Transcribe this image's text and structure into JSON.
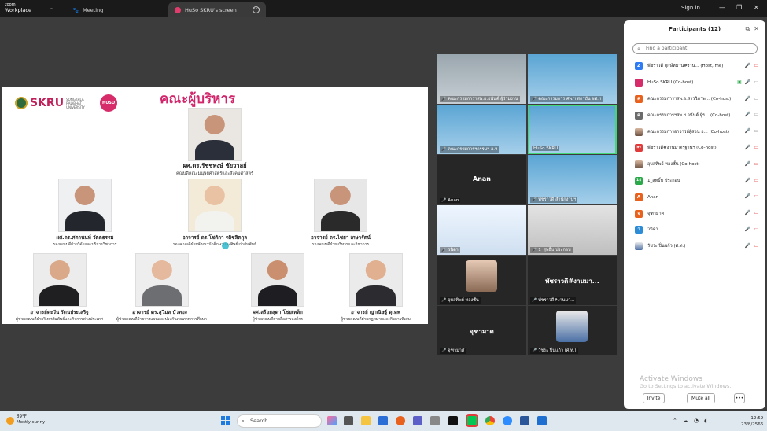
{
  "app": {
    "logo_line1": "zoom",
    "logo_line2": "Workplace",
    "tab_meeting": "Meeting",
    "tab_screen": "HuSo SKRU's screen",
    "signin": "Sign in"
  },
  "slide": {
    "title": "คณะผู้บริหาร",
    "logo_text": "SKRU",
    "logo_sub": "SONGKHLA RAJABHAT UNIVERSITY",
    "huso": "HUSO SKRU",
    "people": [
      {
        "name": "ผศ.ดร.รัชชพงษ์  ชัยวาลย์",
        "role": "คณบดีคณะมนุษยศาสตร์และสังคมศาสตร์"
      },
      {
        "name": "ผศ.ดร.ศตานนท์ วัตตธรรม",
        "role": "รองคณบดีฝ่ายวิจัยและบริการวิชาการ"
      },
      {
        "name": "อาจารย์ ดร.โชติกา รติชลิตกุล",
        "role": "รองคณบดีฝ่ายพัฒนานักศึกษาและศิษย์เก่าสัมพันธ์"
      },
      {
        "name": "อาจารย์ ดร.ไชยา เกษารัตน์",
        "role": "รองคณบดีฝ่ายบริหารและวิชาการ"
      },
      {
        "name": "อาจารย์ตะวัน รัตนประเสริฐ",
        "role": "ผู้ช่วยคณบดีฝ่ายวิเทศสัมพันธ์และกิจการต่างประเทศ"
      },
      {
        "name": "อาจารย์ ดร.สุวิมล บัวทอง",
        "role": "ผู้ช่วยคณบดีฝ่ายวางแผนและประกันคุณภาพการศึกษา"
      },
      {
        "name": "ผศ.สร้อยสุดา โชยเหล็ก",
        "role": "ผู้ช่วยคณบดีฝ่ายสื่อสารองค์กร"
      },
      {
        "name": "อาจารย์ ญาณิษฐ์ ดุเหพ",
        "role": "ผู้ช่วยคณบดีฝ่ายกฎหมายและกิจการพิเศษ"
      }
    ]
  },
  "gallery": {
    "tiles": [
      {
        "label": "คณะกรรมการฯสพ.อ.อนันต์ ผู้ร่วมงาน"
      },
      {
        "label": "คณะกรรมการ ศพ.ฯ สถาบัน ผศ.ฯ"
      },
      {
        "label": "คณะกรรมการฯกรรมฯ อ.ฯ"
      },
      {
        "label": "HuSo SKRU"
      },
      {
        "label": "Anan",
        "big": "Anan"
      },
      {
        "label": "พัชราวดี สำนักงานฯ"
      },
      {
        "label": "วนิดา"
      },
      {
        "label": "1_สุทธิ์บ ประกอบ"
      },
      {
        "label": "อุบลทิพย์ ทองซั้น"
      },
      {
        "label": "พัชราวดี#งานมา...",
        "big": "พัชราวดี#งานมา..."
      },
      {
        "label": "จุฑามาศ",
        "big": "จุฑามาศ"
      },
      {
        "label": "วัชระ ปิ่นแก้ว (ศ.ท.)"
      }
    ]
  },
  "participants": {
    "title": "Participants (12)",
    "search_placeholder": "Find a participant",
    "list": [
      {
        "initial": "Z",
        "color": "#2d7cf6",
        "name": "พัชราวดี ฤกษ์หมาน#งาน... (Host, me)"
      },
      {
        "initial": "",
        "color": "#d62d6a",
        "name": "HuSo SKRU (Co-host)"
      },
      {
        "initial": "ค",
        "color": "#e8621e",
        "name": "คณะกรรมการฯสพ.อ.สาววิภาพ... (Co-host)"
      },
      {
        "initial": "ค",
        "color": "#6b6b6b",
        "name": "คณะกรรมการฯสพ.ฯ.อนันต์ ผู้ร... (Co-host)"
      },
      {
        "initial": "",
        "color": "#888888",
        "name": "คณะกรรมการอาจารย์ผู้สอน อ... (Co-host)"
      },
      {
        "initial": "พจ",
        "color": "#e03c3c",
        "name": "พัชราวดี#งานมาตรฐานฯ (Co-host)"
      },
      {
        "initial": "",
        "color": "#888888",
        "name": "อุบลทิพย์ ทองซั้น (Co-host)"
      },
      {
        "initial": "1ป",
        "color": "#2aa84a",
        "name": "1_สุทธิ์บ ประกอบ"
      },
      {
        "initial": "A",
        "color": "#e8621e",
        "name": "Anan"
      },
      {
        "initial": "จ",
        "color": "#e8621e",
        "name": "จุฑามาศ"
      },
      {
        "initial": "ว",
        "color": "#2d8cd6",
        "name": "วนิดา"
      },
      {
        "initial": "",
        "color": "#888888",
        "name": "วัชระ ปิ่นแก้ว (ศ.ท.)"
      }
    ],
    "invite": "Invite",
    "mute_all": "Mute all"
  },
  "watermark": {
    "line1": "Activate Windows",
    "line2": "Go to Settings to activate Windows."
  },
  "taskbar": {
    "temp": "89°F",
    "weather": "Mostly sunny",
    "search": "Search",
    "time": "12:59",
    "date": "23/8/2566"
  }
}
